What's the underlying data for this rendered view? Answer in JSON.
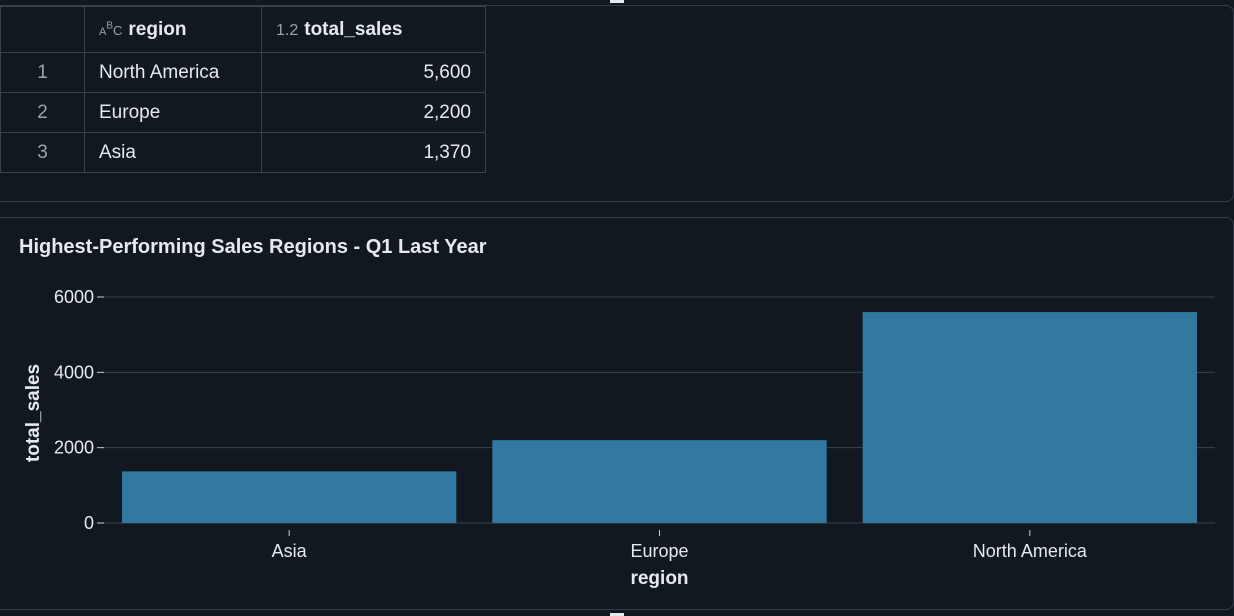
{
  "table": {
    "columns": [
      {
        "type_icon": "text-type-icon",
        "type_label": "ABC",
        "name": "region"
      },
      {
        "type_icon": "decimal-type-icon",
        "type_label": "1.2",
        "name": "total_sales"
      }
    ],
    "rows": [
      {
        "index": "1",
        "region": "North America",
        "total_sales": "5,600"
      },
      {
        "index": "2",
        "region": "Europe",
        "total_sales": "2,200"
      },
      {
        "index": "3",
        "region": "Asia",
        "total_sales": "1,370"
      }
    ]
  },
  "chart_data": {
    "type": "bar",
    "title": "Highest-Performing Sales Regions - Q1 Last Year",
    "categories": [
      "Asia",
      "Europe",
      "North America"
    ],
    "values": [
      1370,
      2200,
      5600
    ],
    "xlabel": "region",
    "ylabel": "total_sales",
    "ylim": [
      0,
      6000
    ],
    "yticks": [
      0,
      2000,
      4000,
      6000
    ],
    "grid": true,
    "bar_color": "#31799f",
    "background": "#121820"
  }
}
